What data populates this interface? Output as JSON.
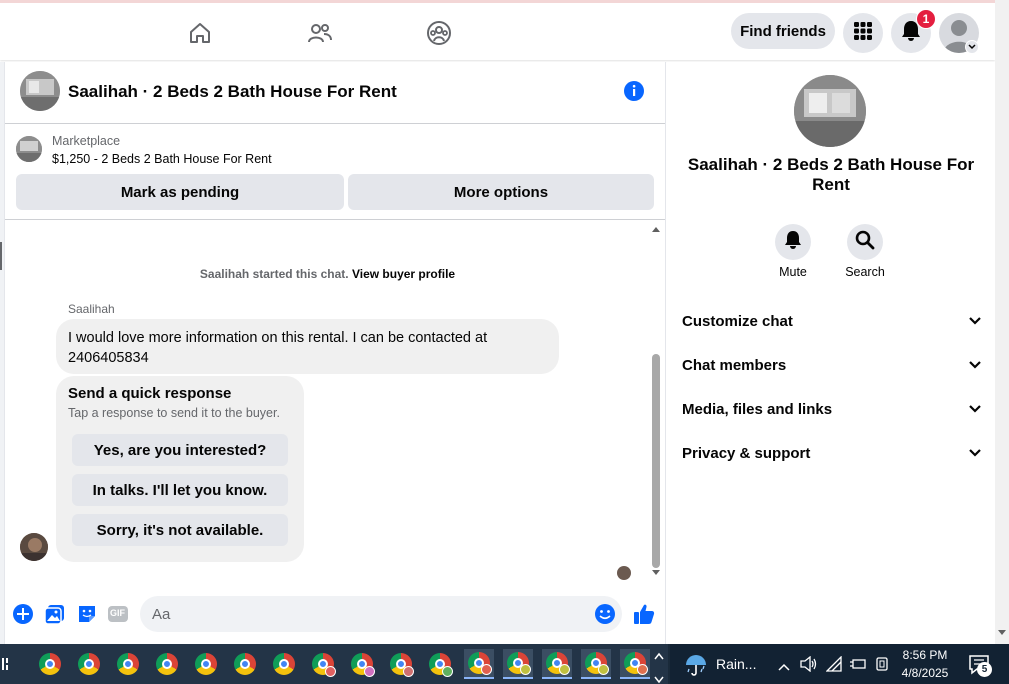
{
  "topnav": {
    "find_friends_label": "Find friends",
    "notification_count": "1"
  },
  "chat": {
    "title": "Saalihah · 2 Beds 2 Bath House For Rent",
    "marketplace": {
      "label": "Marketplace",
      "listing": "$1,250 - 2 Beds 2 Bath House For Rent",
      "mark_pending_label": "Mark as pending",
      "more_options_label": "More options"
    },
    "started_text": "Saalihah started this chat.",
    "view_profile_label": "View buyer profile",
    "sender_name": "Saalihah",
    "message": "I would love more information on this rental. I can be contacted at 2406405834",
    "quick_response": {
      "title": "Send a quick response",
      "subtitle": "Tap a response to send it to the buyer.",
      "options": [
        "Yes, are you interested?",
        "In talks. I'll let you know.",
        "Sorry, it's not available."
      ]
    },
    "composer": {
      "placeholder": "Aa",
      "gif_label": "GIF"
    }
  },
  "right_panel": {
    "title": "Saalihah · 2 Beds 2 Bath House For Rent",
    "actions": [
      {
        "label": "Mute",
        "icon": "bell-icon"
      },
      {
        "label": "Search",
        "icon": "search-icon"
      }
    ],
    "sections": [
      "Customize chat",
      "Chat members",
      "Media, files and links",
      "Privacy & support"
    ]
  },
  "taskbar": {
    "weather_text": "Rain...",
    "time": "8:56 PM",
    "date": "4/8/2025",
    "notification_count": "5"
  },
  "colors": {
    "accent": "#0866ff",
    "button_bg": "#e4e6eb",
    "bubble_bg": "#f0f0f0",
    "badge_red": "#e41e3f",
    "taskbar_bg": "#233447"
  }
}
